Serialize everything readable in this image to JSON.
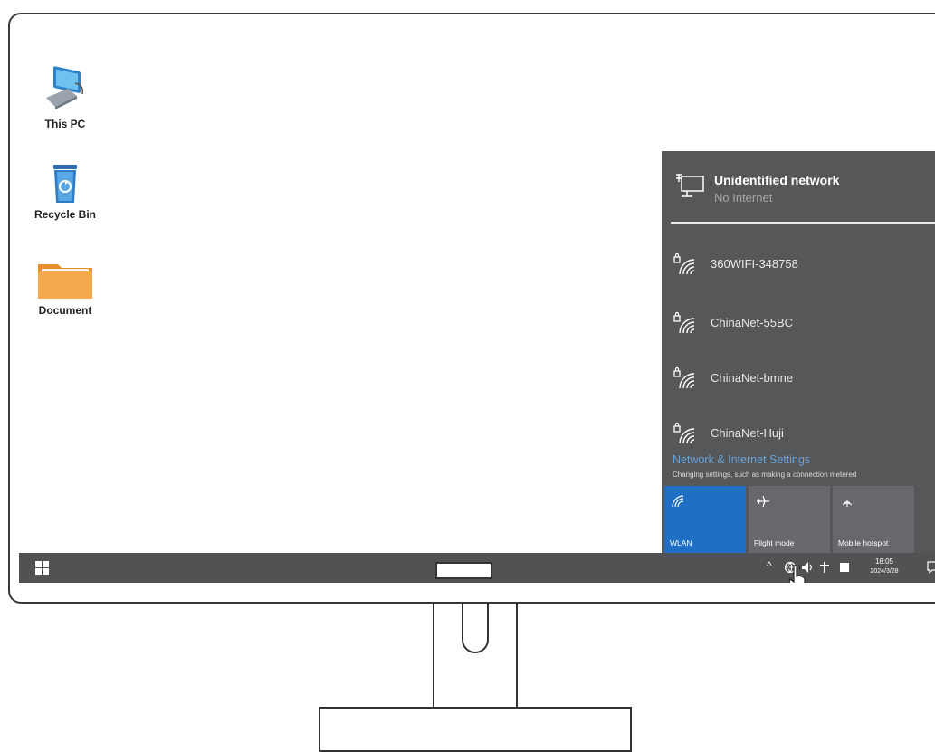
{
  "desktop": {
    "icons": [
      {
        "label": "This PC",
        "icon": "computer-icon"
      },
      {
        "label": "Recycle Bin",
        "icon": "recycle-bin-icon"
      },
      {
        "label": "Document",
        "icon": "folder-icon"
      }
    ]
  },
  "network_panel": {
    "connected": {
      "name": "Unidentified network",
      "status": "No Internet"
    },
    "networks": [
      "360WIFI-348758",
      "ChinaNet-55BC",
      "ChinaNet-bmne",
      "ChinaNet-Huji"
    ],
    "settings_link": "Network & Internet Settings",
    "settings_desc": "Changing settings, such as making a connection metered",
    "quick_actions": [
      {
        "label": "WLAN",
        "active": true
      },
      {
        "label": "Flight mode",
        "active": false
      },
      {
        "label": "Mobile hotspot",
        "active": false
      }
    ]
  },
  "taskbar": {
    "time": "18:05",
    "date": "2024/3/28"
  },
  "colors": {
    "panel_bg": "#555759",
    "accent": "#1f6fc4",
    "taskbar_bg": "#505254",
    "link": "#6aa3d8"
  }
}
